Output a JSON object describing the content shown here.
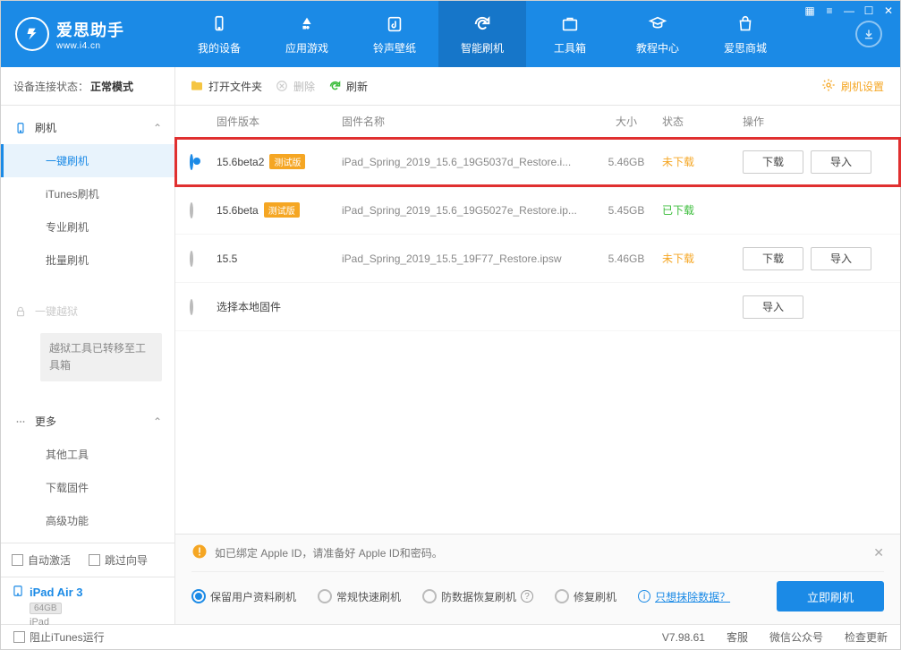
{
  "app": {
    "title": "爱思助手",
    "url": "www.i4.cn"
  },
  "nav": [
    {
      "label": "我的设备",
      "id": "device"
    },
    {
      "label": "应用游戏",
      "id": "apps"
    },
    {
      "label": "铃声壁纸",
      "id": "media"
    },
    {
      "label": "智能刷机",
      "id": "flash",
      "active": true
    },
    {
      "label": "工具箱",
      "id": "tools"
    },
    {
      "label": "教程中心",
      "id": "tutorial"
    },
    {
      "label": "爱思商城",
      "id": "store"
    }
  ],
  "conn": {
    "label": "设备连接状态：",
    "value": "正常模式"
  },
  "toolbar": {
    "open": "打开文件夹",
    "delete": "删除",
    "refresh": "刷新",
    "settings": "刷机设置"
  },
  "sidebar": {
    "flash": {
      "title": "刷机",
      "items": [
        "一键刷机",
        "iTunes刷机",
        "专业刷机",
        "批量刷机"
      ]
    },
    "jailbreak": {
      "title": "一键越狱",
      "note": "越狱工具已转移至工具箱"
    },
    "more": {
      "title": "更多",
      "items": [
        "其他工具",
        "下载固件",
        "高级功能"
      ]
    },
    "auto_activate": "自动激活",
    "skip_guide": "跳过向导",
    "device_name": "iPad Air 3",
    "device_storage": "64GB",
    "device_type": "iPad",
    "block_itunes": "阻止iTunes运行"
  },
  "table": {
    "headers": {
      "ver": "固件版本",
      "name": "固件名称",
      "size": "大小",
      "status": "状态",
      "act": "操作"
    },
    "rows": [
      {
        "selected": true,
        "highlight": true,
        "ver": "15.6beta2",
        "beta": "测试版",
        "name": "iPad_Spring_2019_15.6_19G5037d_Restore.i...",
        "size": "5.46GB",
        "status": "未下载",
        "status_cls": "orange",
        "btns": [
          "下载",
          "导入"
        ]
      },
      {
        "selected": false,
        "ver": "15.6beta",
        "beta": "测试版",
        "name": "iPad_Spring_2019_15.6_19G5027e_Restore.ip...",
        "size": "5.45GB",
        "status": "已下载",
        "status_cls": "green",
        "btns": []
      },
      {
        "selected": false,
        "ver": "15.5",
        "beta": "",
        "name": "iPad_Spring_2019_15.5_19F77_Restore.ipsw",
        "size": "5.46GB",
        "status": "未下载",
        "status_cls": "orange",
        "btns": [
          "下载",
          "导入"
        ]
      },
      {
        "selected": false,
        "ver": "",
        "beta": "",
        "name_override": "选择本地固件",
        "size": "",
        "status": "",
        "status_cls": "",
        "btns": [
          "导入"
        ]
      }
    ]
  },
  "tip": "如已绑定 Apple ID，请准备好 Apple ID和密码。",
  "options": {
    "keep": "保留用户资料刷机",
    "normal": "常规快速刷机",
    "anti": "防数据恢复刷机",
    "repair": "修复刷机",
    "erase": "只想抹除数据？",
    "go": "立即刷机"
  },
  "status": {
    "version": "V7.98.61",
    "cs": "客服",
    "wx": "微信公众号",
    "upd": "检查更新"
  }
}
